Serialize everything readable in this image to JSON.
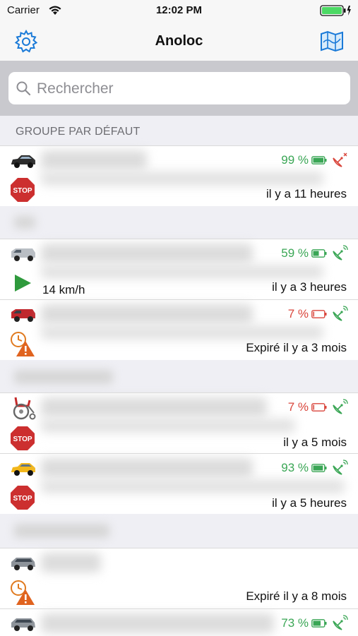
{
  "status_bar": {
    "carrier": "Carrier",
    "time": "12:02 PM"
  },
  "nav": {
    "title": "Anoloc",
    "settings_icon": "gear-icon",
    "map_icon": "map-icon",
    "accent_color": "#1a7ad8"
  },
  "search": {
    "placeholder": "Rechercher"
  },
  "groups": [
    {
      "label": "GROUPE PAR DÉFAUT"
    },
    {
      "label": ""
    },
    {
      "label": ""
    },
    {
      "label": ""
    }
  ],
  "vehicles": [
    {
      "icon": "car-icon",
      "state": "stop-icon",
      "battery": "99 %",
      "battery_level": 0.99,
      "battery_color": "#3aa655",
      "time": "il y a 11 heures",
      "speed": ""
    },
    {
      "icon": "van-icon",
      "state": "play-icon",
      "battery": "59 %",
      "battery_level": 0.59,
      "battery_color": "#3aa655",
      "time": "il y a 3 heures",
      "speed": "14 km/h"
    },
    {
      "icon": "van-icon",
      "state": "expired-warning-icon",
      "battery": "7 %",
      "battery_level": 0.07,
      "battery_color": "#d9463c",
      "time": "Expiré il y a 3 mois",
      "speed": ""
    },
    {
      "icon": "wheelchair-icon",
      "state": "stop-icon",
      "battery": "7 %",
      "battery_level": 0.07,
      "battery_color": "#d9463c",
      "time": "il y a 5 mois",
      "speed": ""
    },
    {
      "icon": "car-icon",
      "state": "stop-icon",
      "battery": "93 %",
      "battery_level": 0.93,
      "battery_color": "#3aa655",
      "time": "il y a 5 heures",
      "speed": ""
    },
    {
      "icon": "minivan-icon",
      "state": "expired-warning-icon",
      "battery": "",
      "battery_level": null,
      "battery_color": "",
      "time": "Expiré il y a 8 mois",
      "speed": ""
    },
    {
      "icon": "minivan-icon",
      "state": "",
      "battery": "73 %",
      "battery_level": 0.73,
      "battery_color": "#3aa655",
      "time": "",
      "speed": ""
    }
  ]
}
